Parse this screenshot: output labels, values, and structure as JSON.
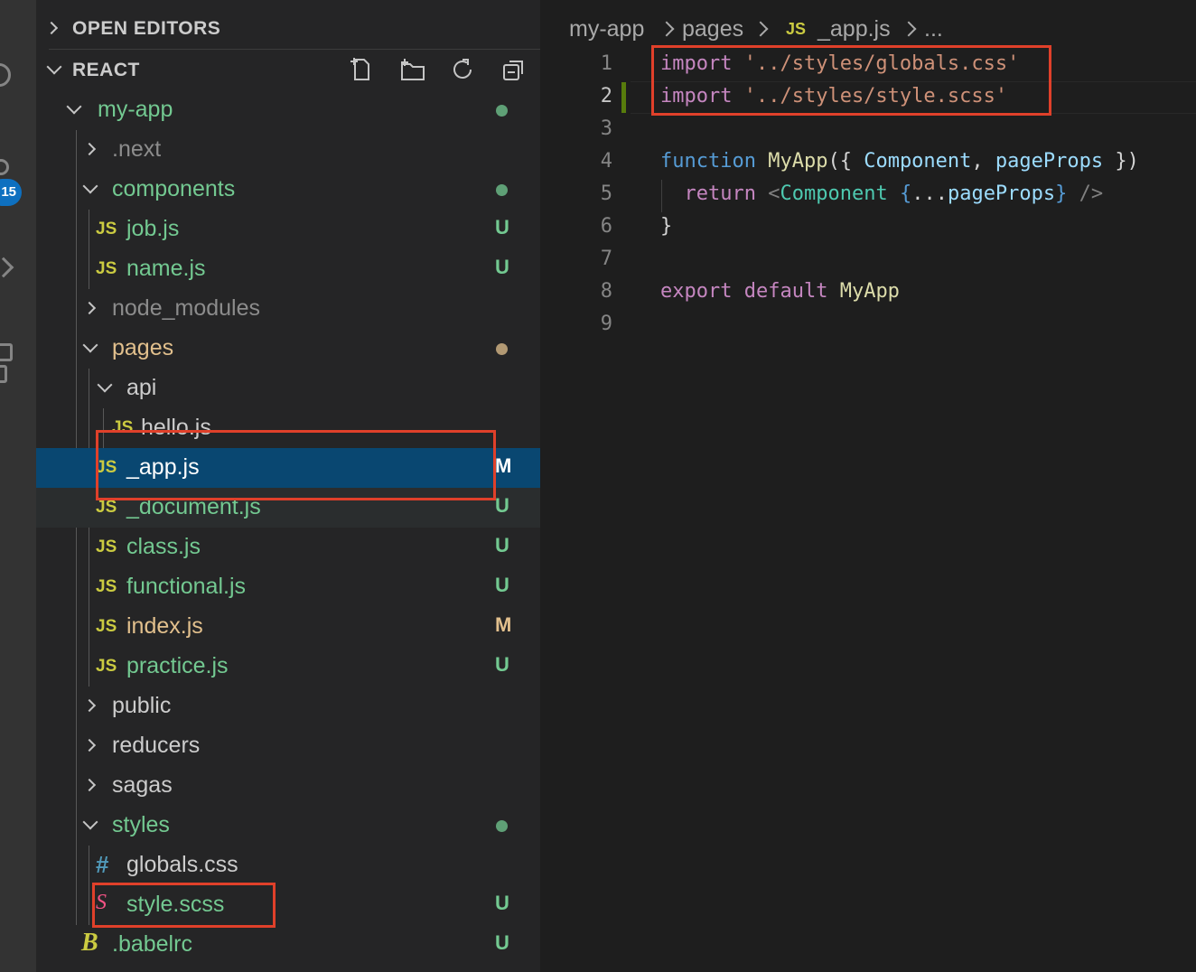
{
  "activity_bar": {
    "badge": "15",
    "icons": [
      "search-icon",
      "source-control-icon",
      "run-debug-icon",
      "extensions-icon"
    ]
  },
  "sidebar": {
    "open_editors": {
      "title": "OPEN EDITORS"
    },
    "workspace": {
      "title": "REACT"
    },
    "toolbar": [
      "new-file-icon",
      "new-folder-icon",
      "refresh-icon",
      "collapse-all-icon"
    ],
    "tree": [
      {
        "label": "my-app",
        "type": "folder",
        "expanded": true,
        "status": "dot",
        "color": "#73c991"
      },
      {
        "label": ".next",
        "type": "folder",
        "expanded": false,
        "color": "#8c8c8c"
      },
      {
        "label": "components",
        "type": "folder",
        "expanded": true,
        "status": "dot",
        "color": "#73c991"
      },
      {
        "label": "job.js",
        "type": "js",
        "status": "U",
        "color": "#73c991"
      },
      {
        "label": "name.js",
        "type": "js",
        "status": "U",
        "color": "#73c991"
      },
      {
        "label": "node_modules",
        "type": "folder",
        "expanded": false,
        "color": "#8c8c8c"
      },
      {
        "label": "pages",
        "type": "folder",
        "expanded": true,
        "status": "dot",
        "color": "#e2c08d"
      },
      {
        "label": "api",
        "type": "folder",
        "expanded": true,
        "color": "#cccccc"
      },
      {
        "label": "hello.js",
        "type": "js",
        "color": "#cccccc"
      },
      {
        "label": "_app.js",
        "type": "js",
        "status": "M",
        "color": "#ffffff"
      },
      {
        "label": "_document.js",
        "type": "js",
        "status": "U",
        "color": "#73c991"
      },
      {
        "label": "class.js",
        "type": "js",
        "status": "U",
        "color": "#73c991"
      },
      {
        "label": "functional.js",
        "type": "js",
        "status": "U",
        "color": "#73c991"
      },
      {
        "label": "index.js",
        "type": "js",
        "status": "M",
        "color": "#e2c08d"
      },
      {
        "label": "practice.js",
        "type": "js",
        "status": "U",
        "color": "#73c991"
      },
      {
        "label": "public",
        "type": "folder",
        "expanded": false,
        "color": "#cccccc"
      },
      {
        "label": "reducers",
        "type": "folder",
        "expanded": false,
        "color": "#cccccc"
      },
      {
        "label": "sagas",
        "type": "folder",
        "expanded": false,
        "color": "#cccccc"
      },
      {
        "label": "styles",
        "type": "folder",
        "expanded": true,
        "status": "dot",
        "color": "#73c991"
      },
      {
        "label": "globals.css",
        "type": "css",
        "color": "#cccccc"
      },
      {
        "label": "style.scss",
        "type": "scss",
        "status": "U",
        "color": "#73c991"
      },
      {
        "label": ".babelrc",
        "type": "babel",
        "status": "U",
        "color": "#73c991"
      }
    ]
  },
  "editor": {
    "breadcrumb": [
      "my-app",
      "pages",
      "_app.js",
      "..."
    ],
    "breadcrumb_file_icon": "JS",
    "line_numbers": [
      "1",
      "2",
      "3",
      "4",
      "5",
      "6",
      "7",
      "8",
      "9"
    ],
    "code": {
      "l1": {
        "kw": "import",
        "str": "'../styles/globals.css'"
      },
      "l2": {
        "kw": "import",
        "str": "'../styles/style.scss'"
      },
      "l4": {
        "fnkw": "function",
        "fn": "MyApp",
        "p1": "({",
        "v1": "Component",
        "p2": ",",
        "v2": "pageProps",
        "p3": "})"
      },
      "l5": {
        "kw": "return",
        "lt": "<",
        "comp": "Component",
        "b1": "{",
        "spread": "...",
        "v": "pageProps",
        "b2": "}",
        "close": "/>"
      },
      "l6": {
        "p": "}"
      },
      "l8": {
        "kw1": "export",
        "kw2": "default",
        "fn": "MyApp"
      }
    }
  },
  "file_icon_glyphs": {
    "js": "JS",
    "css": "#",
    "scss": "S",
    "babel": "B"
  },
  "status_colors": {
    "untracked": "#73c991",
    "modified": "#e2c08d",
    "highlight": "#e0402a"
  }
}
